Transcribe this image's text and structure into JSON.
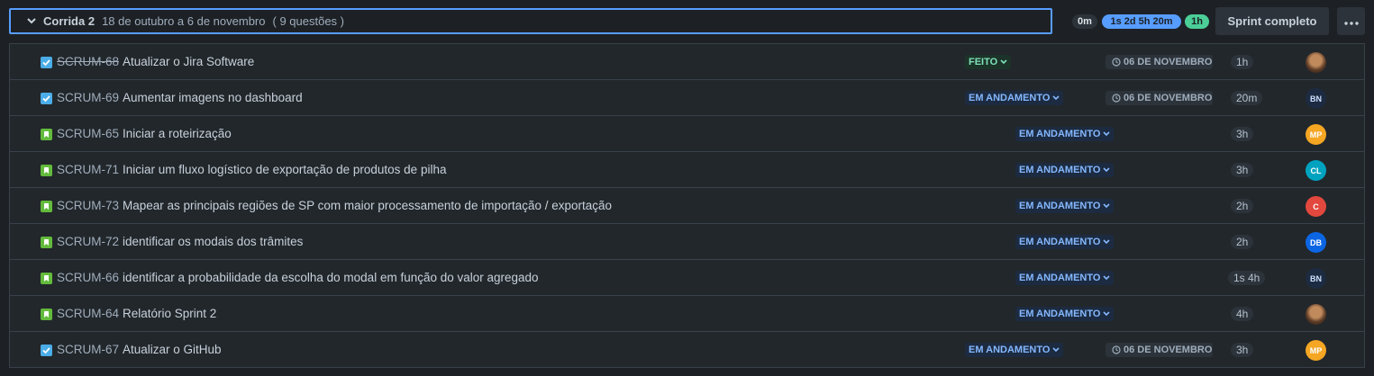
{
  "sprint": {
    "name": "Corrida 2",
    "dates": "18 de outubro a 6 de novembro",
    "count": "( 9 questões )",
    "estimates": {
      "todo": "0m",
      "in_progress": "1s 2d 5h 20m",
      "done": "1h"
    },
    "complete_label": "Sprint completo"
  },
  "issues": [
    {
      "key": "SCRUM-68",
      "summary": "Atualizar o Jira Software",
      "type": "task",
      "status": "FEITO",
      "due": "06 DE NOVEMBRO",
      "estimate": "1h",
      "assignee": "photo",
      "avatar_color": ""
    },
    {
      "key": "SCRUM-69",
      "summary": "Aumentar imagens no dashboard",
      "type": "task",
      "status": "EM ANDAMENTO",
      "due": "06 DE NOVEMBRO",
      "estimate": "20m",
      "assignee": "BN",
      "avatar_color": "#1c2b41"
    },
    {
      "key": "SCRUM-65",
      "summary": "Iniciar a roteirização",
      "type": "story",
      "status": "EM ANDAMENTO",
      "due": "",
      "estimate": "3h",
      "assignee": "MP",
      "avatar_color": "#f5a623"
    },
    {
      "key": "SCRUM-71",
      "summary": "Iniciar um fluxo logístico de exportação de produtos de pilha",
      "type": "story",
      "status": "EM ANDAMENTO",
      "due": "",
      "estimate": "3h",
      "assignee": "CL",
      "avatar_color": "#00a3bf"
    },
    {
      "key": "SCRUM-73",
      "summary": "Mapear as principais regiões de SP com maior processamento de importação / exportação",
      "type": "story",
      "status": "EM ANDAMENTO",
      "due": "",
      "estimate": "2h",
      "assignee": "C",
      "avatar_color": "#e2483d"
    },
    {
      "key": "SCRUM-72",
      "summary": "identificar os modais dos trâmites",
      "type": "story",
      "status": "EM ANDAMENTO",
      "due": "",
      "estimate": "2h",
      "assignee": "DB",
      "avatar_color": "#0c66e4"
    },
    {
      "key": "SCRUM-66",
      "summary": "identificar a probabilidade da escolha do modal em função do valor agregado",
      "type": "story",
      "status": "EM ANDAMENTO",
      "due": "",
      "estimate": "1s 4h",
      "assignee": "BN",
      "avatar_color": "#1c2b41"
    },
    {
      "key": "SCRUM-64",
      "summary": "Relatório Sprint 2",
      "type": "story",
      "status": "EM ANDAMENTO",
      "due": "",
      "estimate": "4h",
      "assignee": "photo",
      "avatar_color": ""
    },
    {
      "key": "SCRUM-67",
      "summary": "Atualizar o GitHub",
      "type": "task",
      "status": "EM ANDAMENTO",
      "due": "06 DE NOVEMBRO",
      "estimate": "3h",
      "assignee": "MP",
      "avatar_color": "#f5a623"
    }
  ]
}
